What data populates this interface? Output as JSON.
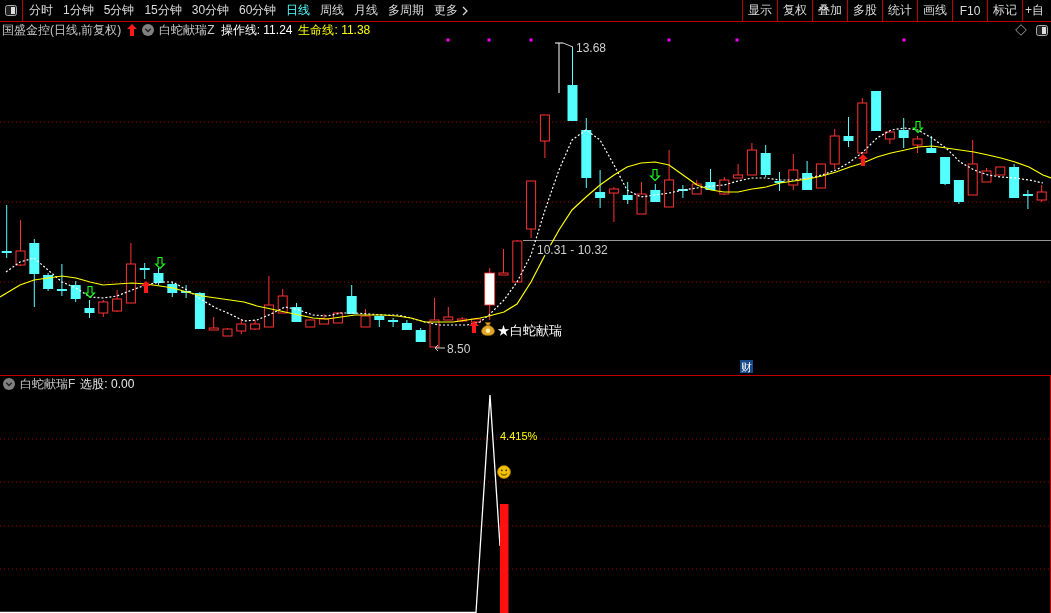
{
  "toolbar": {
    "period_tabs": [
      {
        "label": "分时",
        "selected": false
      },
      {
        "label": "1分钟",
        "selected": false
      },
      {
        "label": "5分钟",
        "selected": false
      },
      {
        "label": "15分钟",
        "selected": false
      },
      {
        "label": "30分钟",
        "selected": false
      },
      {
        "label": "60分钟",
        "selected": false
      },
      {
        "label": "日线",
        "selected": true
      },
      {
        "label": "周线",
        "selected": false
      },
      {
        "label": "月线",
        "selected": false
      },
      {
        "label": "多周期",
        "selected": false
      }
    ],
    "more_menu": "更多",
    "tool_buttons": [
      "显示",
      "复权",
      "叠加",
      "多股",
      "统计",
      "画线",
      "F10",
      "标记",
      "+自"
    ]
  },
  "main_chart": {
    "stock_title": "国盛金控(日线,前复权)",
    "indicator_name": "白蛇献瑞Z",
    "legend": [
      {
        "label": "操作线: 11.24",
        "color": "#ffffff"
      },
      {
        "label": "生命线: 11.38",
        "color": "#ffff00"
      }
    ],
    "high_label": "13.68",
    "low_label": "8.50",
    "range_label": "10.31 - 10.32",
    "signal_label": "★白蛇献瑞",
    "finance_badge": "财"
  },
  "indicator_chart": {
    "indicator_name": "白蛇献瑞F",
    "readout": "选股: 0.00",
    "peak_label": "4.415%"
  }
}
